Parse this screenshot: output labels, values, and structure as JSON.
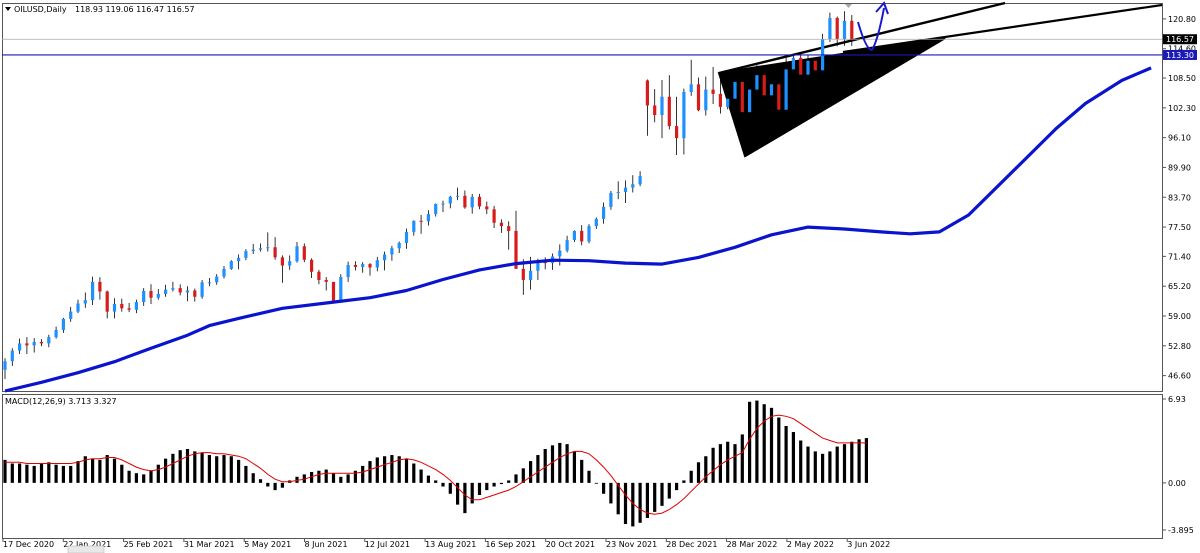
{
  "header": {
    "symbol": "OILUSD,Daily",
    "ohlc": "118.93 119.06 116.47 116.57",
    "menu_icon": "triangle-down-icon"
  },
  "macd_header": "MACD(12,26,9) 3.713 3.327",
  "colors": {
    "bull": "#1e90ff",
    "bear": "#d81b1b",
    "ma": "#0a14cc",
    "hline": "#1a1ab8",
    "macd_hist": "#000000",
    "macd_signal": "#e00000",
    "wedge": "#000000"
  },
  "chart_data": [
    {
      "type": "candlestick",
      "title": "OILUSD,Daily",
      "price_axis_ticks": [
        "120.80",
        "114.60",
        "108.50",
        "102.30",
        "96.10",
        "89.90",
        "83.70",
        "77.50",
        "71.40",
        "65.20",
        "59.00",
        "52.80",
        "46.60"
      ],
      "ylim": [
        43.4,
        123.9
      ],
      "x_tick_labels": [
        "17 Dec 2020",
        "22 Jan 2021",
        "25 Feb 2021",
        "31 Mar 2021",
        "5 May 2021",
        "8 Jun 2021",
        "12 Jul 2021",
        "13 Aug 2021",
        "16 Sep 2021",
        "20 Oct 2021",
        "23 Nov 2021",
        "28 Dec 2021",
        "28 Mar 2022",
        "2 May 2022",
        "3 Jun 2022"
      ],
      "current_price_label": "116.57",
      "horizontal_line": {
        "value": 113.3,
        "label": "113.30"
      },
      "moving_average": {
        "name": "MA",
        "points": [
          [
            0,
            43.4
          ],
          [
            5,
            45.2
          ],
          [
            10,
            47.2
          ],
          [
            15,
            49.5
          ],
          [
            20,
            52.3
          ],
          [
            25,
            55.0
          ],
          [
            28,
            57.0
          ],
          [
            32,
            58.5
          ],
          [
            38,
            60.6
          ],
          [
            45,
            61.9
          ],
          [
            50,
            62.8
          ],
          [
            55,
            64.3
          ],
          [
            60,
            66.6
          ],
          [
            65,
            68.6
          ],
          [
            70,
            69.9
          ],
          [
            75,
            70.6
          ],
          [
            80,
            70.5
          ],
          [
            85,
            70.0
          ],
          [
            90,
            69.8
          ],
          [
            95,
            71.2
          ],
          [
            100,
            73.3
          ],
          [
            105,
            75.9
          ],
          [
            110,
            77.5
          ],
          [
            115,
            77.1
          ],
          [
            120,
            76.5
          ],
          [
            124,
            76.1
          ],
          [
            128,
            76.5
          ],
          [
            132,
            80.0
          ],
          [
            136,
            86.0
          ],
          [
            140,
            92.0
          ],
          [
            144,
            98.0
          ],
          [
            148,
            103.2
          ],
          [
            153,
            108.0
          ],
          [
            157,
            110.6
          ]
        ]
      },
      "candles": [
        [
          47.8,
          50.2,
          45.9,
          49.6
        ],
        [
          49.6,
          52.3,
          48.6,
          51.8
        ],
        [
          51.8,
          54.3,
          51.1,
          53.3
        ],
        [
          53.3,
          54.6,
          51.1,
          52.9
        ],
        [
          52.9,
          54.4,
          51.4,
          53.6
        ],
        [
          53.6,
          54.2,
          52.7,
          53.3
        ],
        [
          53.3,
          55.1,
          52.5,
          54.6
        ],
        [
          54.6,
          56.8,
          54.3,
          56.1
        ],
        [
          56.1,
          58.6,
          55.5,
          58.4
        ],
        [
          58.4,
          60.9,
          57.8,
          59.9
        ],
        [
          59.9,
          62.4,
          59.6,
          61.6
        ],
        [
          61.6,
          63.9,
          60.7,
          62.3
        ],
        [
          62.3,
          67.2,
          61.3,
          66.1
        ],
        [
          66.1,
          67.1,
          62.4,
          64.1
        ],
        [
          64.1,
          64.3,
          58.5,
          59.9
        ],
        [
          59.9,
          62.7,
          58.5,
          61.5
        ],
        [
          61.5,
          62.6,
          59.9,
          60.6
        ],
        [
          60.6,
          61.7,
          59.8,
          60.3
        ],
        [
          60.3,
          62.4,
          59.6,
          61.9
        ],
        [
          61.9,
          64.8,
          61.1,
          64.2
        ],
        [
          64.2,
          65.6,
          61.5,
          62.8
        ],
        [
          62.8,
          64.6,
          62.4,
          63.6
        ],
        [
          63.6,
          65.5,
          63.0,
          64.5
        ],
        [
          64.5,
          66.1,
          64.1,
          64.8
        ],
        [
          64.8,
          65.6,
          63.3,
          63.9
        ],
        [
          63.9,
          65.2,
          62.1,
          64.3
        ],
        [
          64.3,
          64.7,
          62.0,
          63.0
        ],
        [
          63.0,
          66.5,
          62.6,
          66.0
        ],
        [
          66.0,
          66.9,
          65.2,
          66.0
        ],
        [
          66.0,
          67.7,
          65.5,
          67.2
        ],
        [
          67.2,
          69.4,
          66.8,
          68.8
        ],
        [
          68.8,
          70.6,
          68.6,
          70.4
        ],
        [
          70.4,
          71.8,
          68.7,
          71.1
        ],
        [
          71.1,
          72.9,
          70.6,
          72.5
        ],
        [
          72.5,
          74.0,
          71.9,
          72.8
        ],
        [
          72.8,
          74.1,
          72.4,
          73.1
        ],
        [
          73.1,
          76.4,
          72.4,
          73.3
        ],
        [
          73.3,
          75.4,
          70.7,
          71.2
        ],
        [
          71.2,
          71.6,
          65.9,
          69.5
        ],
        [
          69.5,
          71.6,
          68.6,
          70.4
        ],
        [
          70.4,
          74.4,
          70.1,
          73.5
        ],
        [
          73.5,
          74.1,
          70.2,
          70.7
        ],
        [
          70.7,
          71.0,
          66.9,
          68.2
        ],
        [
          68.2,
          68.6,
          65.6,
          66.5
        ],
        [
          66.5,
          67.1,
          64.3,
          66.1
        ],
        [
          66.1,
          66.1,
          61.9,
          62.1
        ],
        [
          62.1,
          67.7,
          61.8,
          67.1
        ],
        [
          67.1,
          70.3,
          66.1,
          69.6
        ],
        [
          69.6,
          70.4,
          68.5,
          69.2
        ],
        [
          69.2,
          70.2,
          68.0,
          69.8
        ],
        [
          69.8,
          70.0,
          67.4,
          69.1
        ],
        [
          69.1,
          71.3,
          68.3,
          70.6
        ],
        [
          70.6,
          72.4,
          68.5,
          71.8
        ],
        [
          71.8,
          73.6,
          70.5,
          73.1
        ],
        [
          73.1,
          74.5,
          72.1,
          74.2
        ],
        [
          74.2,
          77.2,
          73.0,
          76.5
        ],
        [
          76.5,
          78.9,
          75.7,
          78.8
        ],
        [
          78.8,
          80.0,
          76.1,
          78.7
        ],
        [
          78.7,
          81.0,
          77.8,
          80.2
        ],
        [
          80.2,
          82.4,
          79.7,
          82.3
        ],
        [
          82.3,
          83.0,
          80.6,
          82.4
        ],
        [
          82.4,
          84.0,
          81.4,
          83.8
        ],
        [
          83.8,
          85.7,
          83.1,
          84.0
        ],
        [
          84.0,
          85.1,
          81.3,
          81.6
        ],
        [
          81.6,
          84.4,
          80.3,
          83.8
        ],
        [
          83.8,
          84.4,
          81.2,
          81.8
        ],
        [
          81.8,
          82.8,
          80.2,
          81.2
        ],
        [
          81.2,
          81.9,
          77.3,
          78.4
        ],
        [
          78.4,
          79.1,
          76.3,
          77.7
        ],
        [
          77.7,
          78.7,
          72.8,
          76.7
        ],
        [
          76.7,
          80.9,
          70.0,
          68.8
        ],
        [
          68.8,
          70.8,
          63.4,
          66.5
        ],
        [
          66.5,
          71.3,
          64.5,
          68.4
        ],
        [
          68.4,
          70.9,
          66.5,
          70.2
        ],
        [
          70.2,
          71.2,
          68.7,
          70.0
        ],
        [
          70.0,
          72.0,
          68.6,
          71.4
        ],
        [
          71.4,
          73.9,
          69.5,
          72.6
        ],
        [
          72.6,
          75.7,
          72.2,
          74.8
        ],
        [
          74.8,
          76.8,
          74.4,
          76.7
        ],
        [
          76.7,
          77.9,
          73.7,
          74.5
        ],
        [
          74.5,
          78.1,
          74.1,
          77.7
        ],
        [
          77.7,
          79.5,
          77.1,
          79.2
        ],
        [
          79.2,
          82.6,
          78.2,
          81.7
        ],
        [
          81.7,
          85.0,
          81.1,
          84.6
        ],
        [
          84.6,
          87.0,
          83.3,
          84.8
        ],
        [
          84.8,
          87.2,
          82.5,
          85.7
        ],
        [
          85.7,
          88.3,
          84.7,
          86.4
        ],
        [
          86.4,
          89.1,
          86.0,
          88.1
        ],
        [
          108.0,
          108.2,
          96.5,
          102.8
        ],
        [
          102.8,
          106.2,
          99.3,
          100.8
        ],
        [
          100.8,
          108.1,
          96.0,
          104.6
        ],
        [
          104.6,
          109.1,
          97.8,
          98.5
        ],
        [
          98.5,
          104.6,
          92.5,
          96.0
        ],
        [
          96.0,
          106.3,
          92.6,
          105.6
        ],
        [
          105.6,
          112.3,
          104.8,
          107.2
        ],
        [
          107.2,
          108.6,
          101.6,
          101.8
        ],
        [
          101.8,
          108.8,
          100.7,
          106.1
        ],
        [
          106.1,
          110.8,
          103.1,
          105.2
        ],
        [
          105.2,
          108.2,
          101.1,
          102.5
        ],
        [
          102.5,
          107.1,
          102.0,
          104.2
        ],
        [
          104.2,
          108.1,
          102.3,
          107.7
        ],
        [
          107.7,
          108.9,
          100.3,
          101.4
        ],
        [
          101.4,
          107.2,
          100.6,
          106.1
        ],
        [
          106.1,
          111.2,
          105.3,
          109.1
        ],
        [
          109.1,
          109.8,
          104.5,
          104.9
        ],
        [
          104.9,
          107.6,
          103.7,
          107.2
        ],
        [
          107.2,
          111.2,
          100.2,
          101.9
        ],
        [
          101.9,
          112.8,
          100.1,
          110.3
        ],
        [
          110.3,
          113.6,
          109.6,
          112.7
        ],
        [
          112.7,
          113.8,
          105.7,
          109.2
        ],
        [
          109.2,
          113.3,
          106.8,
          112.1
        ],
        [
          112.1,
          112.2,
          107.5,
          110.1
        ],
        [
          110.1,
          117.7,
          109.0,
          116.6
        ],
        [
          116.6,
          122.1,
          116.0,
          121.0
        ],
        [
          121.0,
          121.3,
          115.1,
          116.6
        ],
        [
          116.6,
          122.4,
          115.2,
          120.4
        ],
        [
          120.4,
          121.6,
          115.2,
          116.6
        ]
      ],
      "annotations": [
        "wedge",
        "trendlines",
        "projection-arrow"
      ]
    },
    {
      "type": "bar",
      "title": "MACD(12,26,9)",
      "values": {
        "macd": 3.713,
        "signal": 3.327
      },
      "axis_ticks": [
        "6.93",
        "0.00",
        "-3.895"
      ],
      "ylim": [
        -3.895,
        6.93
      ],
      "histogram": [
        1.9,
        1.6,
        1.6,
        1.5,
        1.4,
        1.6,
        1.7,
        1.5,
        1.4,
        1.4,
        1.8,
        2.2,
        2.0,
        1.9,
        2.3,
        2.0,
        1.5,
        1.0,
        0.8,
        0.7,
        1.0,
        1.5,
        2.0,
        2.4,
        2.7,
        2.8,
        2.6,
        2.5,
        2.3,
        2.2,
        2.3,
        2.2,
        1.9,
        1.4,
        0.8,
        0.3,
        -0.3,
        -0.6,
        -0.4,
        0.2,
        0.5,
        0.7,
        0.9,
        1.0,
        1.1,
        0.8,
        0.5,
        0.7,
        1.0,
        1.4,
        1.8,
        2.1,
        2.2,
        2.3,
        2.2,
        2.0,
        1.6,
        1.1,
        0.6,
        0.2,
        -0.3,
        -0.9,
        -1.8,
        -2.5,
        -1.7,
        -1.0,
        -0.6,
        -0.3,
        -0.1,
        0.2,
        0.7,
        1.2,
        1.8,
        2.3,
        2.8,
        3.1,
        3.3,
        3.2,
        2.6,
        1.9,
        1.0,
        0.0,
        -0.9,
        -1.7,
        -2.6,
        -3.4,
        -3.6,
        -3.3,
        -2.9,
        -2.4,
        -1.9,
        -1.3,
        -0.6,
        0.2,
        1.0,
        1.7,
        2.2,
        2.9,
        3.2,
        3.4,
        3.2,
        4.0,
        6.7,
        6.8,
        6.5,
        6.2,
        5.4,
        4.7,
        4.2,
        3.5,
        3.0,
        2.6,
        2.4,
        2.6,
        3.0,
        3.2,
        3.4,
        3.6,
        3.7
      ],
      "signal_line": [
        1.7,
        1.7,
        1.7,
        1.6,
        1.6,
        1.6,
        1.6,
        1.6,
        1.6,
        1.6,
        1.7,
        1.9,
        2.0,
        2.0,
        2.1,
        2.1,
        1.9,
        1.6,
        1.3,
        1.1,
        1.0,
        1.1,
        1.3,
        1.6,
        1.9,
        2.2,
        2.4,
        2.5,
        2.5,
        2.4,
        2.4,
        2.3,
        2.2,
        2.0,
        1.6,
        1.2,
        0.7,
        0.3,
        0.1,
        0.1,
        0.2,
        0.3,
        0.5,
        0.7,
        0.8,
        0.8,
        0.8,
        0.8,
        0.8,
        0.9,
        1.1,
        1.3,
        1.5,
        1.7,
        1.9,
        2.0,
        1.9,
        1.7,
        1.4,
        1.1,
        0.7,
        0.2,
        -0.4,
        -1.0,
        -1.4,
        -1.4,
        -1.2,
        -1.0,
        -0.8,
        -0.6,
        -0.3,
        0.1,
        0.5,
        0.9,
        1.3,
        1.7,
        2.1,
        2.4,
        2.6,
        2.6,
        2.4,
        1.9,
        1.3,
        0.6,
        -0.2,
        -1.0,
        -1.7,
        -2.2,
        -2.5,
        -2.6,
        -2.5,
        -2.2,
        -1.8,
        -1.3,
        -0.7,
        -0.1,
        0.5,
        1.0,
        1.5,
        1.9,
        2.2,
        2.5,
        3.6,
        4.5,
        5.1,
        5.5,
        5.6,
        5.5,
        5.3,
        4.9,
        4.5,
        4.1,
        3.7,
        3.5,
        3.3,
        3.3,
        3.3,
        3.3,
        3.3
      ]
    }
  ]
}
